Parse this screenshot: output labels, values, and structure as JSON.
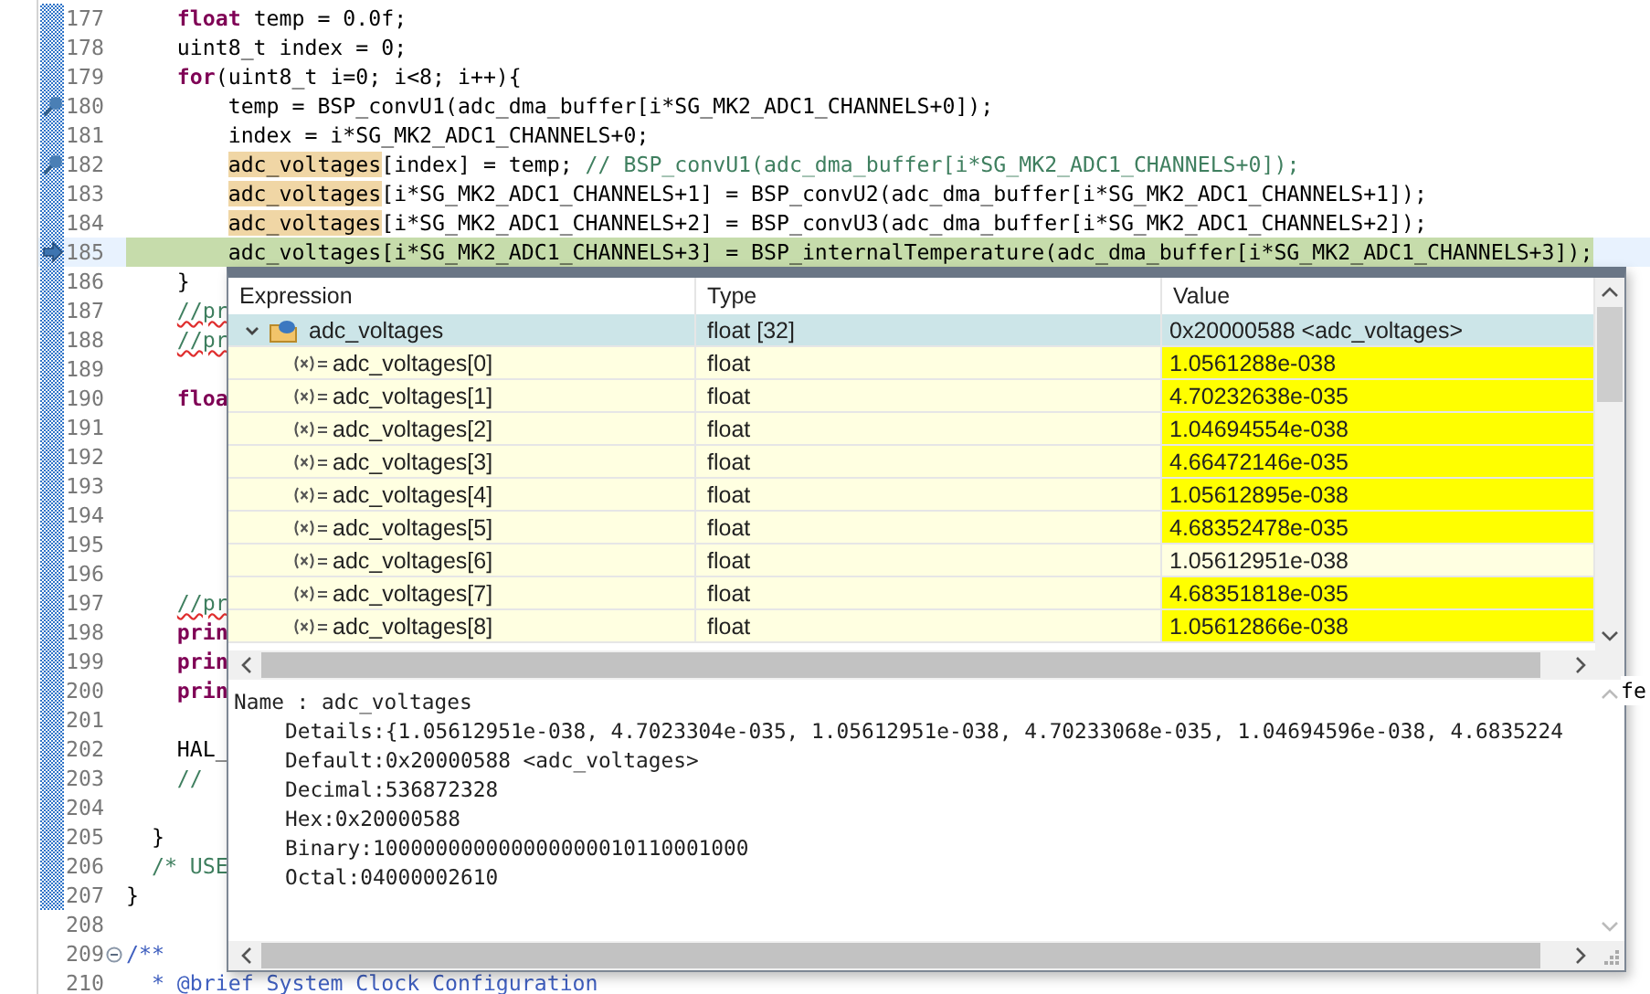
{
  "code_lines": [
    {
      "number": "177",
      "changed": true,
      "current": false,
      "breakpoint": false,
      "collapsible": false,
      "tokens": [
        {
          "text": "    float",
          "kind": "keyword"
        },
        {
          "text": " temp = 0.0f;",
          "kind": "code"
        }
      ]
    },
    {
      "number": "178",
      "changed": true,
      "current": false,
      "breakpoint": false,
      "collapsible": false,
      "tokens": [
        {
          "text": "    uint8_t index = 0;",
          "kind": "code"
        }
      ]
    },
    {
      "number": "179",
      "changed": true,
      "current": false,
      "breakpoint": false,
      "collapsible": false,
      "tokens": [
        {
          "text": "    for",
          "kind": "keyword"
        },
        {
          "text": "(uint8_t i=0; i<8; i++){",
          "kind": "code"
        }
      ]
    },
    {
      "number": "180",
      "changed": true,
      "current": false,
      "breakpoint": true,
      "collapsible": false,
      "tokens": [
        {
          "text": "        temp = BSP_convU1(adc_dma_buffer[i*SG_MK2_ADC1_CHANNELS+0]);",
          "kind": "code"
        }
      ]
    },
    {
      "number": "181",
      "changed": true,
      "current": false,
      "breakpoint": false,
      "collapsible": false,
      "tokens": [
        {
          "text": "        index = i*SG_MK2_ADC1_CHANNELS+0;",
          "kind": "code"
        }
      ]
    },
    {
      "number": "182",
      "changed": true,
      "current": false,
      "breakpoint": true,
      "collapsible": false,
      "tokens": [
        {
          "text": "        adc_voltages",
          "kind": "match"
        },
        {
          "text": "[index] = temp; ",
          "kind": "code"
        },
        {
          "text": "// BSP_convU1(adc_dma_buffer[i*SG_MK2_ADC1_CHANNELS+0]);",
          "kind": "comment"
        }
      ]
    },
    {
      "number": "183",
      "changed": true,
      "current": false,
      "breakpoint": false,
      "collapsible": false,
      "tokens": [
        {
          "text": "        adc_voltages",
          "kind": "match"
        },
        {
          "text": "[i*SG_MK2_ADC1_CHANNELS+1] = BSP_convU2(adc_dma_buffer[i*SG_MK2_ADC1_CHANNELS+1]);",
          "kind": "code"
        }
      ]
    },
    {
      "number": "184",
      "changed": true,
      "current": false,
      "breakpoint": false,
      "collapsible": false,
      "tokens": [
        {
          "text": "        adc_voltages",
          "kind": "match"
        },
        {
          "text": "[i*SG_MK2_ADC1_CHANNELS+2] = BSP_convU3(adc_dma_buffer[i*SG_MK2_ADC1_CHANNELS+2]);",
          "kind": "code"
        }
      ]
    },
    {
      "number": "185",
      "changed": true,
      "current": true,
      "breakpoint": false,
      "collapsible": false,
      "tokens": [
        {
          "text": "        adc_voltages[i*SG_MK2_ADC1_CHANNELS+3] = BSP_internalTemperature(adc_dma_buffer[i*SG_MK2_ADC1_CHANNELS+3]);",
          "kind": "code"
        }
      ]
    },
    {
      "number": "186",
      "changed": true,
      "current": false,
      "breakpoint": false,
      "collapsible": false,
      "tokens": [
        {
          "text": "    }",
          "kind": "code"
        }
      ]
    },
    {
      "number": "187",
      "changed": true,
      "current": false,
      "breakpoint": false,
      "collapsible": false,
      "tokens": [
        {
          "text": "    //pr",
          "kind": "typo"
        }
      ]
    },
    {
      "number": "188",
      "changed": true,
      "current": false,
      "breakpoint": false,
      "collapsible": false,
      "tokens": [
        {
          "text": "    //pr",
          "kind": "typo"
        }
      ]
    },
    {
      "number": "189",
      "changed": true,
      "current": false,
      "breakpoint": false,
      "collapsible": false
    },
    {
      "number": "190",
      "changed": true,
      "current": false,
      "breakpoint": false,
      "collapsible": false,
      "tokens": [
        {
          "text": "    floa",
          "kind": "keyword"
        }
      ]
    },
    {
      "number": "191",
      "changed": true,
      "current": false,
      "breakpoint": false,
      "collapsible": false
    },
    {
      "number": "192",
      "changed": true,
      "current": false,
      "breakpoint": false,
      "collapsible": false
    },
    {
      "number": "193",
      "changed": true,
      "current": false,
      "breakpoint": false,
      "collapsible": false
    },
    {
      "number": "194",
      "changed": true,
      "current": false,
      "breakpoint": false,
      "collapsible": false
    },
    {
      "number": "195",
      "changed": true,
      "current": false,
      "breakpoint": false,
      "collapsible": false
    },
    {
      "number": "196",
      "changed": true,
      "current": false,
      "breakpoint": false,
      "collapsible": false
    },
    {
      "number": "197",
      "changed": true,
      "current": false,
      "breakpoint": false,
      "collapsible": false,
      "tokens": [
        {
          "text": "    //pr",
          "kind": "typo"
        }
      ]
    },
    {
      "number": "198",
      "changed": true,
      "current": false,
      "breakpoint": false,
      "collapsible": false,
      "tokens": [
        {
          "text": "    prin",
          "kind": "keyword"
        }
      ]
    },
    {
      "number": "199",
      "changed": true,
      "current": false,
      "breakpoint": false,
      "collapsible": false,
      "tokens": [
        {
          "text": "    prin",
          "kind": "keyword"
        }
      ]
    },
    {
      "number": "200",
      "changed": true,
      "current": false,
      "breakpoint": false,
      "collapsible": false,
      "tail": "fe",
      "tokens": [
        {
          "text": "    prin",
          "kind": "keyword"
        }
      ]
    },
    {
      "number": "201",
      "changed": true,
      "current": false,
      "breakpoint": false,
      "collapsible": false
    },
    {
      "number": "202",
      "changed": true,
      "current": false,
      "breakpoint": false,
      "collapsible": false,
      "tokens": [
        {
          "text": "    HAL_",
          "kind": "code"
        }
      ]
    },
    {
      "number": "203",
      "changed": true,
      "current": false,
      "breakpoint": false,
      "collapsible": false,
      "tokens": [
        {
          "text": "    //",
          "kind": "comment"
        }
      ]
    },
    {
      "number": "204",
      "changed": true,
      "current": false,
      "breakpoint": false,
      "collapsible": false
    },
    {
      "number": "205",
      "changed": true,
      "current": false,
      "breakpoint": false,
      "collapsible": false,
      "tokens": [
        {
          "text": "  }",
          "kind": "code"
        }
      ]
    },
    {
      "number": "206",
      "changed": true,
      "current": false,
      "breakpoint": false,
      "collapsible": false,
      "tokens": [
        {
          "text": "  /* USE",
          "kind": "comment"
        }
      ]
    },
    {
      "number": "207",
      "changed": true,
      "current": false,
      "breakpoint": false,
      "collapsible": false,
      "tokens": [
        {
          "text": "}",
          "kind": "code"
        }
      ]
    },
    {
      "number": "208",
      "changed": false,
      "current": false,
      "breakpoint": false,
      "collapsible": false
    },
    {
      "number": "209",
      "changed": false,
      "current": false,
      "breakpoint": false,
      "collapsible": true,
      "tokens": [
        {
          "text": "/**",
          "kind": "doc"
        }
      ]
    },
    {
      "number": "210",
      "changed": false,
      "current": false,
      "breakpoint": false,
      "collapsible": false,
      "tokens": [
        {
          "text": "  * @brief System Clock Configuration",
          "kind": "doc"
        }
      ]
    }
  ],
  "hover": {
    "columns": [
      "Expression",
      "Type",
      "Value"
    ],
    "root": {
      "name": "adc_voltages",
      "type": "float [32]",
      "value": "0x20000588 <adc_voltages>",
      "expanded": true,
      "selected": true
    },
    "children": [
      {
        "name": "adc_voltages[0]",
        "type": "float",
        "value": "1.0561288e-038",
        "changed": true
      },
      {
        "name": "adc_voltages[1]",
        "type": "float",
        "value": "4.70232638e-035",
        "changed": true
      },
      {
        "name": "adc_voltages[2]",
        "type": "float",
        "value": "1.04694554e-038",
        "changed": true
      },
      {
        "name": "adc_voltages[3]",
        "type": "float",
        "value": "4.66472146e-035",
        "changed": true
      },
      {
        "name": "adc_voltages[4]",
        "type": "float",
        "value": "1.05612895e-038",
        "changed": true
      },
      {
        "name": "adc_voltages[5]",
        "type": "float",
        "value": "4.68352478e-035",
        "changed": true
      },
      {
        "name": "adc_voltages[6]",
        "type": "float",
        "value": "1.05612951e-038",
        "changed": false
      },
      {
        "name": "adc_voltages[7]",
        "type": "float",
        "value": "4.68351818e-035",
        "changed": true
      },
      {
        "name": "adc_voltages[8]",
        "type": "float",
        "value": "1.05612866e-038",
        "changed": true
      }
    ],
    "details": [
      "Name : adc_voltages",
      "Details:{1.05612951e-038, 4.7023304e-035, 1.05612951e-038, 4.70233068e-035, 1.04694596e-038, 4.6835224",
      "Default:0x20000588 <adc_voltages>",
      "Decimal:536872328",
      "Hex:0x20000588",
      "Binary:100000000000000000010110001000",
      "Octal:04000002610"
    ]
  }
}
